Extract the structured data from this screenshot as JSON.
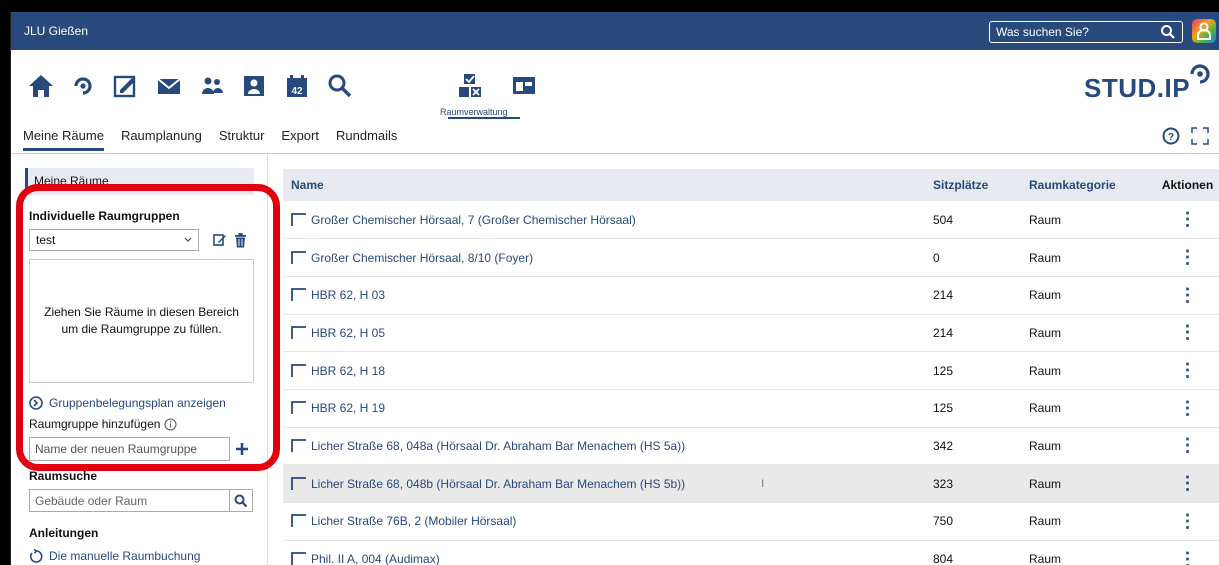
{
  "app": {
    "title": "JLU Gießen"
  },
  "search": {
    "placeholder": "Was suchen Sie?"
  },
  "nav": {
    "active_label": "Raumverwaltung"
  },
  "logo": {
    "text": "STUD.IP"
  },
  "subnav": {
    "tabs": [
      "Meine Räume",
      "Raumplanung",
      "Struktur",
      "Export",
      "Rundmails"
    ]
  },
  "sidebar": {
    "header": "Meine Räume",
    "groups_title": "Individuelle Raumgruppen",
    "group_selected": "test",
    "dropzone_text": "Ziehen Sie Räume in diesen Bereich um die Raumgruppe zu füllen.",
    "plan_link": "Gruppenbelegungsplan anzeigen",
    "add_group_label": "Raumgruppe hinzufügen",
    "add_group_placeholder": "Name der neuen Raumgruppe",
    "room_search_title": "Raumsuche",
    "room_search_placeholder": "Gebäude oder Raum",
    "guides_title": "Anleitungen",
    "guide_link": "Die manuelle Raumbuchung"
  },
  "table": {
    "headers": [
      "Name",
      "Sitzplätze",
      "Raumkategorie",
      "Aktionen"
    ],
    "rows": [
      {
        "name": "Großer Chemischer Hörsaal, 7 (Großer Chemischer Hörsaal)",
        "seats": "504",
        "category": "Raum"
      },
      {
        "name": "Großer Chemischer Hörsaal, 8/10 (Foyer)",
        "seats": "0",
        "category": "Raum"
      },
      {
        "name": "HBR 62, H 03",
        "seats": "214",
        "category": "Raum"
      },
      {
        "name": "HBR 62, H 05",
        "seats": "214",
        "category": "Raum"
      },
      {
        "name": "HBR 62, H 18",
        "seats": "125",
        "category": "Raum"
      },
      {
        "name": "HBR 62, H 19",
        "seats": "125",
        "category": "Raum"
      },
      {
        "name": "Licher Straße 68, 048a (Hörsaal Dr. Abraham Bar Menachem (HS 5a))",
        "seats": "342",
        "category": "Raum"
      },
      {
        "name": "Licher Straße 68, 048b (Hörsaal Dr. Abraham Bar Menachem (HS 5b))",
        "seats": "323",
        "category": "Raum"
      },
      {
        "name": "Licher Straße 76B, 2 (Mobiler Hörsaal)",
        "seats": "750",
        "category": "Raum"
      },
      {
        "name": "Phil. II A, 004 (Audimax)",
        "seats": "804",
        "category": "Raum"
      }
    ]
  },
  "colors": {
    "brand": "#28497c",
    "highlight_ring": "#e3000f"
  }
}
